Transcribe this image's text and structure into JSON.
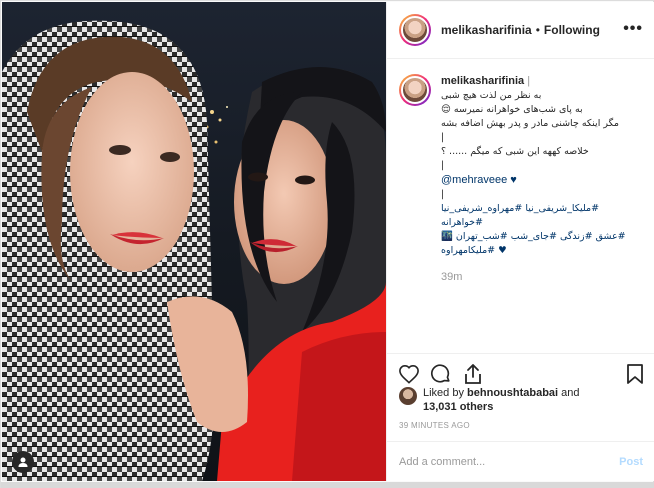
{
  "post": {
    "username": "melikasharifinia",
    "separator": "•",
    "follow_status": "Following",
    "more_label": "•••"
  },
  "caption": {
    "username": "melikasharifinia",
    "username_suffix": "|",
    "lines": [
      "به نظر من لذت هیچ شبی",
      "به پای شب‌های خواهرانه نمیرسه 😌",
      "مگر اینکه چاشنی مادر و پدر بهش اضافه بشه",
      "|",
      "خلاصه کههه این شبی که میگم ...... ؟",
      "|"
    ],
    "mention": "@mehraveee ♥",
    "mention_after": "|",
    "hashtags": [
      "#ملیکا_شریفی_نیا #مهراوه_شریفی_نیا #خواهرانه",
      "#عشق #زندگی #جای_شب #شب_تهران 🌃",
      "♥ #ملیکامهراوه"
    ],
    "time": "39m"
  },
  "likes": {
    "prefix": "Liked by",
    "liker": "behnoushtababai",
    "conjunction": "and",
    "count": "13,031 others"
  },
  "timestamp": "39 MINUTES AGO",
  "comment_box": {
    "placeholder": "Add a comment...",
    "post_label": "Post"
  },
  "icons": {
    "like": "heart-icon",
    "comment": "comment-icon",
    "share": "share-icon",
    "save": "bookmark-icon",
    "tag": "user-tag-icon"
  },
  "colors": {
    "link": "#003569",
    "muted": "#999999",
    "post_button": "#b3dbff"
  }
}
